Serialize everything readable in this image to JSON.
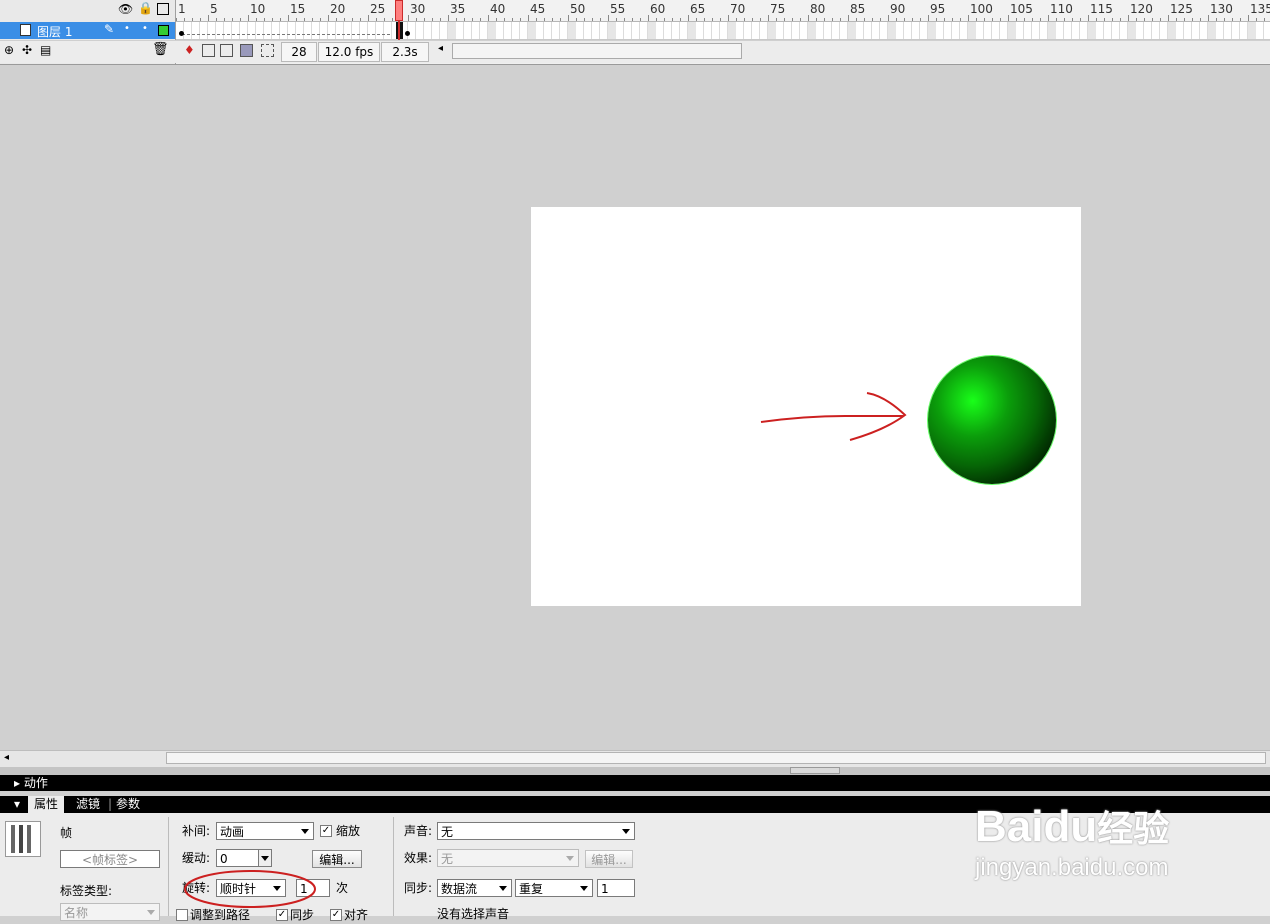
{
  "timeline": {
    "ruler_labels": [
      "1",
      "5",
      "10",
      "15",
      "20",
      "25",
      "30",
      "35",
      "40",
      "45",
      "50",
      "55",
      "60",
      "65",
      "70",
      "75",
      "80",
      "85",
      "90",
      "95",
      "100",
      "105",
      "110",
      "115",
      "120",
      "125",
      "130",
      "135"
    ],
    "layer_name": "图层 1",
    "current_frame": "28",
    "frame_rate": "12.0 fps",
    "elapsed_time": "2.3s"
  },
  "panels": {
    "actions_title": "动作",
    "tabs": [
      "属性",
      "滤镜",
      "参数"
    ]
  },
  "properties": {
    "frame_label": "帧",
    "frame_label_placeholder": "<帧标签>",
    "label_type_label": "标签类型:",
    "label_type_value": "名称",
    "tween_label": "补间:",
    "tween_value": "动画",
    "scale_label": "缩放",
    "ease_label": "缓动:",
    "ease_value": "0",
    "edit_button": "编辑...",
    "rotate_label": "旋转:",
    "rotate_value": "顺时针",
    "rotate_times": "1",
    "times_unit": "次",
    "orient_to_path": "调整到路径",
    "sync_label_check": "同步",
    "snap_label": "对齐",
    "sound_label": "声音:",
    "sound_value": "无",
    "effect_label": "效果:",
    "effect_value": "无",
    "effect_edit_button": "编辑...",
    "sync_label": "同步:",
    "sync_value": "数据流",
    "repeat_value": "重复",
    "repeat_count": "1",
    "no_sound_text": "没有选择声音"
  },
  "watermark": {
    "brand": "Baidu",
    "brand_cn": "经验",
    "url": "jingyan.baidu.com"
  },
  "colors": {
    "annotation": "#cc2020",
    "selection": "#3a8ee6",
    "ball": "#0b9e0b"
  }
}
